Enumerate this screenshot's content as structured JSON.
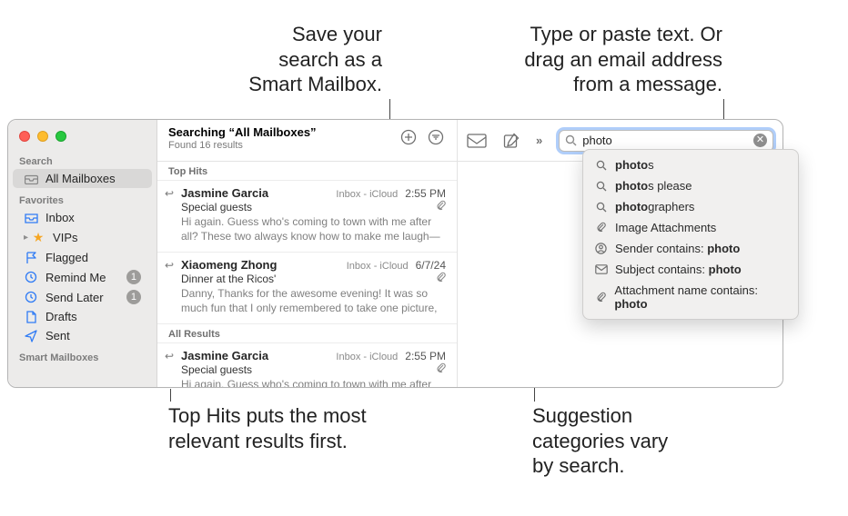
{
  "callouts": {
    "smart_mailbox": "Save your\nsearch as a\nSmart Mailbox.",
    "type_drag": "Type or paste text. Or\ndrag an email address\nfrom a message.",
    "top_hits": "Top Hits puts the most\nrelevant results first.",
    "suggestions": "Suggestion\ncategories vary\nby search."
  },
  "sidebar": {
    "search_heading": "Search",
    "all_mailboxes": "All Mailboxes",
    "favorites_heading": "Favorites",
    "items": [
      {
        "icon": "inbox",
        "label": "Inbox"
      },
      {
        "icon": "star",
        "label": "VIPs",
        "disclosure": true
      },
      {
        "icon": "flag",
        "label": "Flagged"
      },
      {
        "icon": "clock",
        "label": "Remind Me",
        "badge": "1"
      },
      {
        "icon": "clock",
        "label": "Send Later",
        "badge": "1"
      },
      {
        "icon": "doc",
        "label": "Drafts"
      },
      {
        "icon": "sent",
        "label": "Sent"
      }
    ],
    "smart_heading": "Smart Mailboxes"
  },
  "list": {
    "title": "Searching “All Mailboxes”",
    "subtitle": "Found 16 results",
    "top_hits_label": "Top Hits",
    "all_results_label": "All Results",
    "messages": [
      {
        "sender": "Jasmine Garcia",
        "subject": "Special guests",
        "mailbox": "Inbox - iCloud",
        "date": "2:55 PM",
        "attach": true,
        "preview": "Hi again. Guess who's coming to town with me after all? These two always know how to make me laugh—and they're as insepa..."
      },
      {
        "sender": "Xiaomeng Zhong",
        "subject": "Dinner at the Ricos'",
        "mailbox": "Inbox - iCloud",
        "date": "6/7/24",
        "attach": true,
        "preview": "Danny, Thanks for the awesome evening! It was so much fun that I only remembered to take one picture, but at least it's a good..."
      },
      {
        "sender": "Jasmine Garcia",
        "subject": "Special guests",
        "mailbox": "Inbox - iCloud",
        "date": "2:55 PM",
        "attach": true,
        "preview": "Hi again. Guess who's coming to town with me after all? These two always know how to make me laugh—and they're as insepa..."
      }
    ]
  },
  "search": {
    "value": "photo"
  },
  "suggestions": [
    {
      "icon": "search",
      "pre": "photo",
      "post": "s"
    },
    {
      "icon": "search",
      "pre": "photo",
      "post": "s please"
    },
    {
      "icon": "search",
      "pre": "photo",
      "post": "graphers"
    },
    {
      "icon": "attach",
      "label": "Image Attachments"
    },
    {
      "icon": "person",
      "label": "Sender contains: ",
      "bold": "photo"
    },
    {
      "icon": "mail",
      "label": "Subject contains: ",
      "bold": "photo"
    },
    {
      "icon": "attach",
      "label": "Attachment name contains: ",
      "bold": "photo"
    }
  ]
}
